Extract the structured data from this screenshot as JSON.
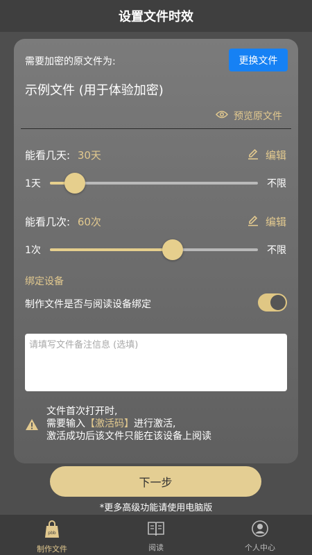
{
  "header": {
    "title": "设置文件时效"
  },
  "source": {
    "label": "需要加密的原文件为:",
    "change_button": "更换文件",
    "filename": "示例文件 (用于体验加密)",
    "preview_label": "预览原文件"
  },
  "days": {
    "label": "能看几天:",
    "value_text": "30天",
    "edit_label": "编辑",
    "min_label": "1天",
    "max_label": "不限",
    "slider_fraction": 0.12
  },
  "times": {
    "label": "能看几次:",
    "value_text": "60次",
    "edit_label": "编辑",
    "min_label": "1次",
    "max_label": "不限",
    "slider_fraction": 0.59
  },
  "binding": {
    "section_title": "绑定设备",
    "toggle_label": "制作文件是否与阅读设备绑定",
    "toggle_on": true
  },
  "note": {
    "placeholder": "请填写文件备注信息 (选填)",
    "value": ""
  },
  "warning": {
    "line1": "文件首次打开时,",
    "line2_pre": "需要输入",
    "line2_code": "【激活码】",
    "line2_post": "进行激活,",
    "line3": "激活成功后该文件只能在该设备上阅读"
  },
  "next_button": "下一步",
  "footnote": "*更多高级功能请使用电脑版",
  "tabs": [
    {
      "label": "制作文件",
      "active": true
    },
    {
      "label": "阅读",
      "active": false
    },
    {
      "label": "个人中心",
      "active": false
    }
  ],
  "colors": {
    "accent_gold": "#e2c98f",
    "button_blue": "#1681f4",
    "background": "#4e4e4e"
  }
}
